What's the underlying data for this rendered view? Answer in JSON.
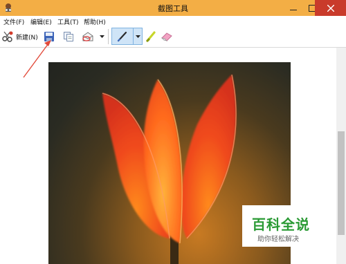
{
  "window": {
    "title": "截图工具"
  },
  "menu": {
    "items": [
      "文件(F)",
      "编辑(E)",
      "工具(T)",
      "帮助(H)"
    ]
  },
  "toolbar": {
    "new_label": "新建(N)",
    "icons": [
      "new-snip-icon",
      "save-icon",
      "copy-icon",
      "send-snip-icon",
      "pen-icon",
      "highlighter-icon",
      "eraser-icon"
    ]
  },
  "watermark": {
    "title": "百科全说",
    "subtitle": "助你轻松解决"
  },
  "colors": {
    "titlebar": "#f3ae45",
    "close": "#c93b2b",
    "arrow": "#e24a3a",
    "watermark_green": "#2a9a34"
  }
}
